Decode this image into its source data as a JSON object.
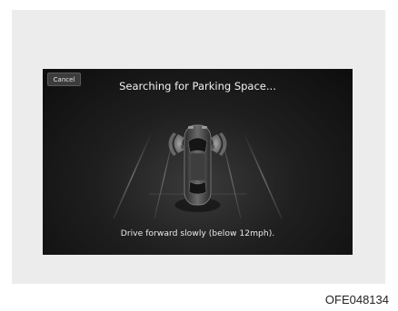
{
  "screen": {
    "cancel_label": "Cancel",
    "title": "Searching for Parking Space...",
    "message": "Drive forward slowly (below 12mph)."
  },
  "figure_code": "OFE048134",
  "icons": {
    "vehicle": "car-top-view-icon",
    "left_sensor": "sensor-wave-icon",
    "right_sensor": "sensor-wave-icon"
  }
}
